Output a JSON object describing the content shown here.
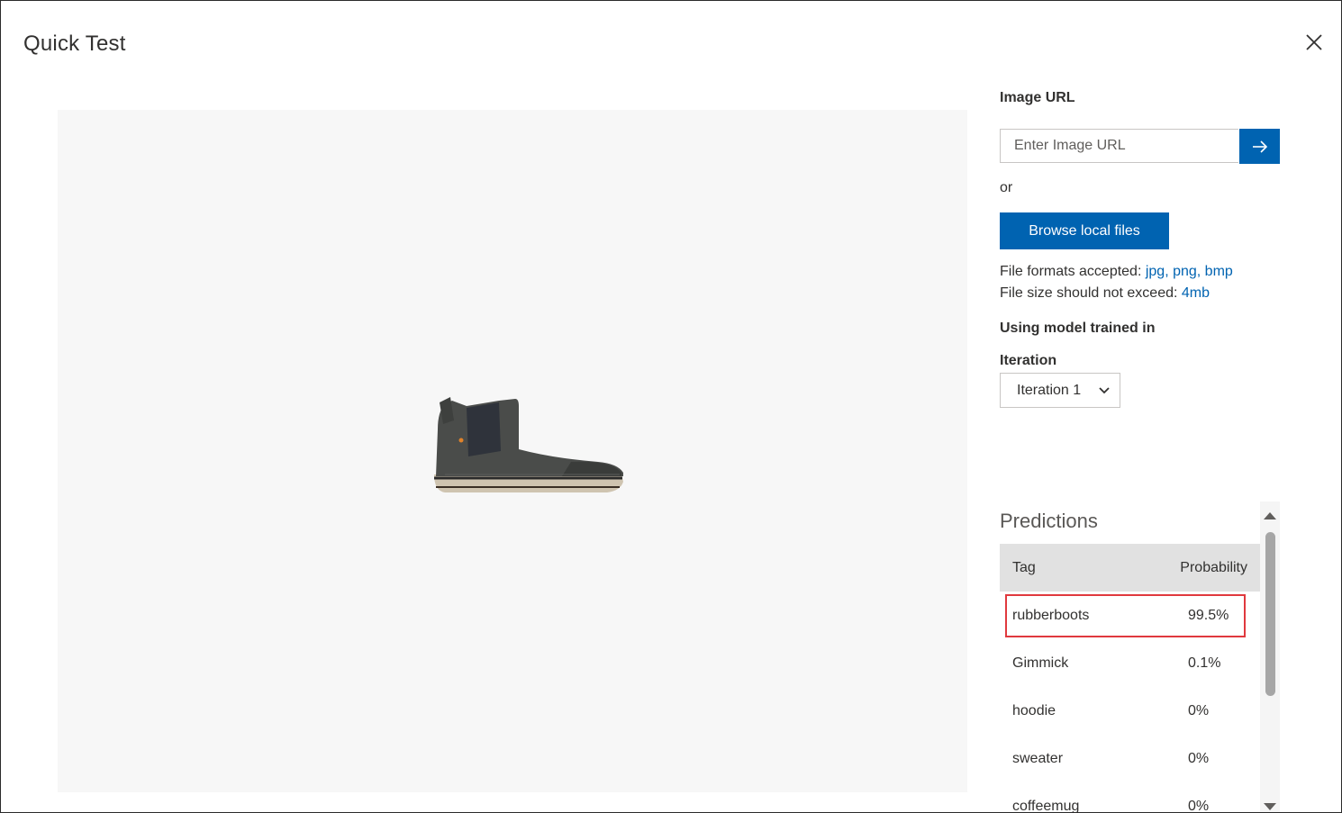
{
  "dialog": {
    "title": "Quick Test",
    "close_icon": "close-icon"
  },
  "preview": {
    "image_subject": "rubber chelsea boot"
  },
  "image_url": {
    "label": "Image URL",
    "placeholder": "Enter Image URL",
    "submit_icon": "arrow-right-icon"
  },
  "or_text": "or",
  "browse_button": "Browse local files",
  "file_formats": {
    "label": "File formats accepted: ",
    "value": "jpg, png, bmp"
  },
  "file_size": {
    "label": "File size should not exceed: ",
    "value": "4mb"
  },
  "model_label": "Using model trained in",
  "iteration": {
    "label": "Iteration",
    "selected": "Iteration 1"
  },
  "predictions": {
    "title": "Predictions",
    "columns": [
      "Tag",
      "Probability"
    ],
    "rows": [
      {
        "tag": "rubberboots",
        "probability": "99.5%"
      },
      {
        "tag": "Gimmick",
        "probability": "0.1%"
      },
      {
        "tag": "hoodie",
        "probability": "0%"
      },
      {
        "tag": "sweater",
        "probability": "0%"
      },
      {
        "tag": "coffeemug",
        "probability": "0%"
      }
    ]
  },
  "colors": {
    "accent": "#0063b1",
    "highlight": "#e0393e",
    "preview_bg": "#f7f7f7",
    "table_header_bg": "#e1e1e1"
  }
}
